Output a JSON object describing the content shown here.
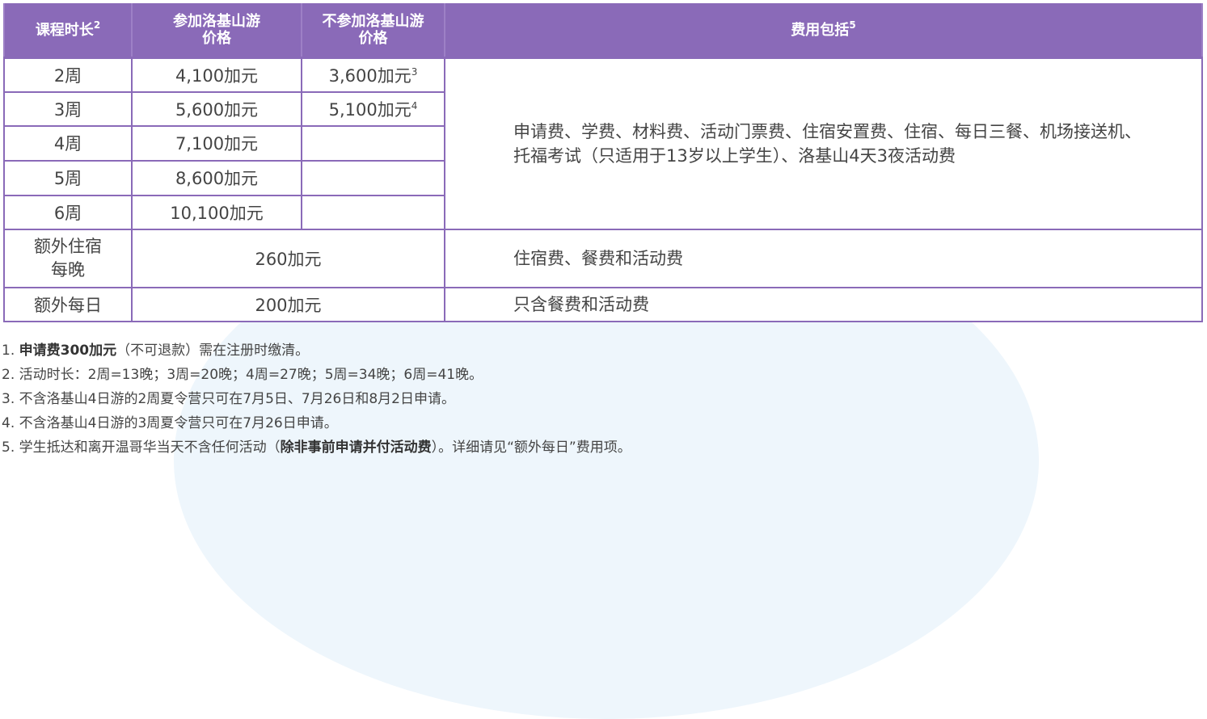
{
  "header": {
    "col1": "课程时长",
    "col1_sup": "2",
    "col2_line1": "参加洛基山游",
    "col2_line2": "价格",
    "col3_line1": "不参加洛基山游",
    "col3_line2": "价格",
    "col4": "费用包括",
    "col4_sup": "5"
  },
  "rows": [
    {
      "duration": "2周",
      "with_rockies": "4,100加元",
      "without_rockies": "3,600加元",
      "without_sup": "3"
    },
    {
      "duration": "3周",
      "with_rockies": "5,600加元",
      "without_rockies": "5,100加元",
      "without_sup": "4"
    },
    {
      "duration": "4周",
      "with_rockies": "7,100加元",
      "without_rockies": ""
    },
    {
      "duration": "5周",
      "with_rockies": "8,600加元",
      "without_rockies": ""
    },
    {
      "duration": "6周",
      "with_rockies": "10,100加元",
      "without_rockies": ""
    }
  ],
  "includes_main": "申请费、学费、材料费、活动门票费、住宿安置费、住宿、每日三餐、机场接送机、托福考试（只适用于13岁以上学生）、洛基山4天3夜活动费",
  "extra_night": {
    "label_line1": "额外住宿",
    "label_line2": "每晚",
    "price": "260加元",
    "includes": "住宿费、餐费和活动费"
  },
  "extra_day": {
    "label": "额外每日",
    "price": "200加元",
    "includes": "只含餐费和活动费"
  },
  "notes": {
    "n1_prefix": "1. ",
    "n1_bold": "申请费300加元",
    "n1_rest": "（不可退款）需在注册时缴清。",
    "n2": "2. 活动时长：2周=13晚；3周=20晚；4周=27晚；5周=34晚；6周=41晚。",
    "n3": "3. 不含洛基山4日游的2周夏令营只可在7月5日、7月26日和8月2日申请。",
    "n4": "4. 不含洛基山4日游的3周夏令营只可在7月26日申请。",
    "n5_prefix": "5. 学生抵达和离开温哥华当天不含任何活动（",
    "n5_bold": "除非事前申请并付活动费",
    "n5_rest": "）。详细请见“额外每日”费用项。"
  },
  "colors": {
    "header_purple": "#8a6ab8",
    "text_gray": "#444444",
    "background_arc": "#eef6fc"
  }
}
